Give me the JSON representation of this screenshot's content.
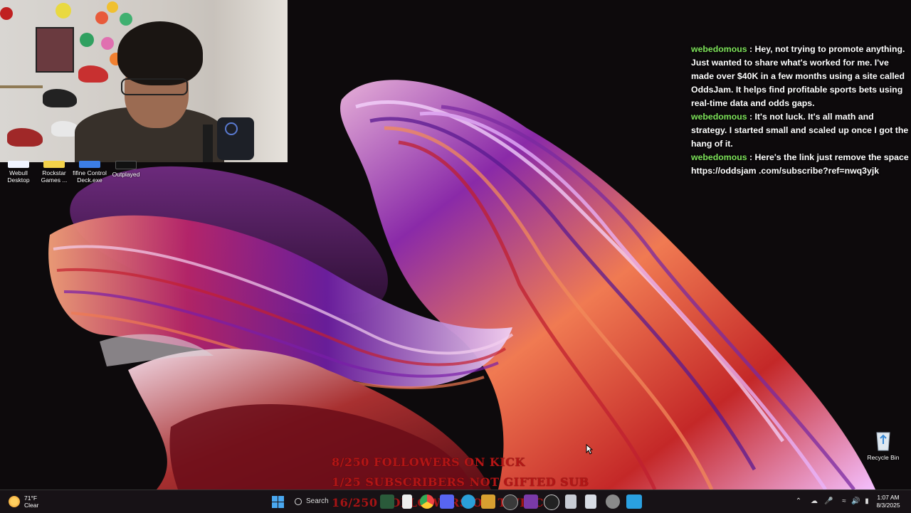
{
  "desktop": {
    "icons": [
      {
        "label": "Webull\nDesktop",
        "icon": "webull-icon",
        "color": "#f0f4ff"
      },
      {
        "label": "Rockstar\nGames ...",
        "icon": "rockstar-icon",
        "color": "#f3d24a"
      },
      {
        "label": "fifine Control\nDeck.exe",
        "icon": "fifine-icon",
        "color": "#3c7ee6"
      },
      {
        "label": "Outplayed",
        "icon": "outplayed-icon",
        "color": "#111111"
      }
    ],
    "recycle_bin": {
      "label": "Recycle Bin",
      "icon": "recycle-bin-icon"
    }
  },
  "chat": {
    "messages": [
      {
        "user": "webedomous",
        "text": "Hey, not trying to promote anything. Just wanted to share what's worked for me. I've made over $40K in a few months using a site called OddsJam. It helps find profitable sports bets using real-time data and odds gaps."
      },
      {
        "user": "webedomous",
        "text": "It's not luck. It's all math and strategy. I started small and scaled up once I got the hang of it."
      },
      {
        "user": "webedomous",
        "text": "Here's the link just remove the space https://oddsjam .com/subscribe?ref=nwq3yjk"
      }
    ],
    "separator": " : ",
    "username_color": "#7ee35a"
  },
  "goals": [
    "8/250 FOLLOWERS ON KICK",
    "1/25 SUBSCRIBERS NOT GIFTED SUB",
    "16/250 FOLLOWERS ON TWITCH"
  ],
  "taskbar": {
    "weather": {
      "temp": "71°F",
      "condition": "Clear"
    },
    "search_label": "Search",
    "clock": {
      "time": "1:07 AM",
      "date": "8/3/2025"
    },
    "apps": [
      "start-icon",
      "search-icon",
      "task-view-icon",
      "file-explorer-icon",
      "chrome-icon",
      "discord-icon",
      "edge-icon",
      "steam-icon",
      "obs-icon",
      "notepad-icon",
      "store-icon",
      "settings-icon",
      "app-f-icon"
    ],
    "tray": [
      "chevron-up-icon",
      "cloud-icon",
      "microphone-icon",
      "wifi-icon",
      "speaker-icon",
      "battery-icon"
    ]
  },
  "colors": {
    "accent": "#b31616",
    "taskbar": "#181418"
  }
}
